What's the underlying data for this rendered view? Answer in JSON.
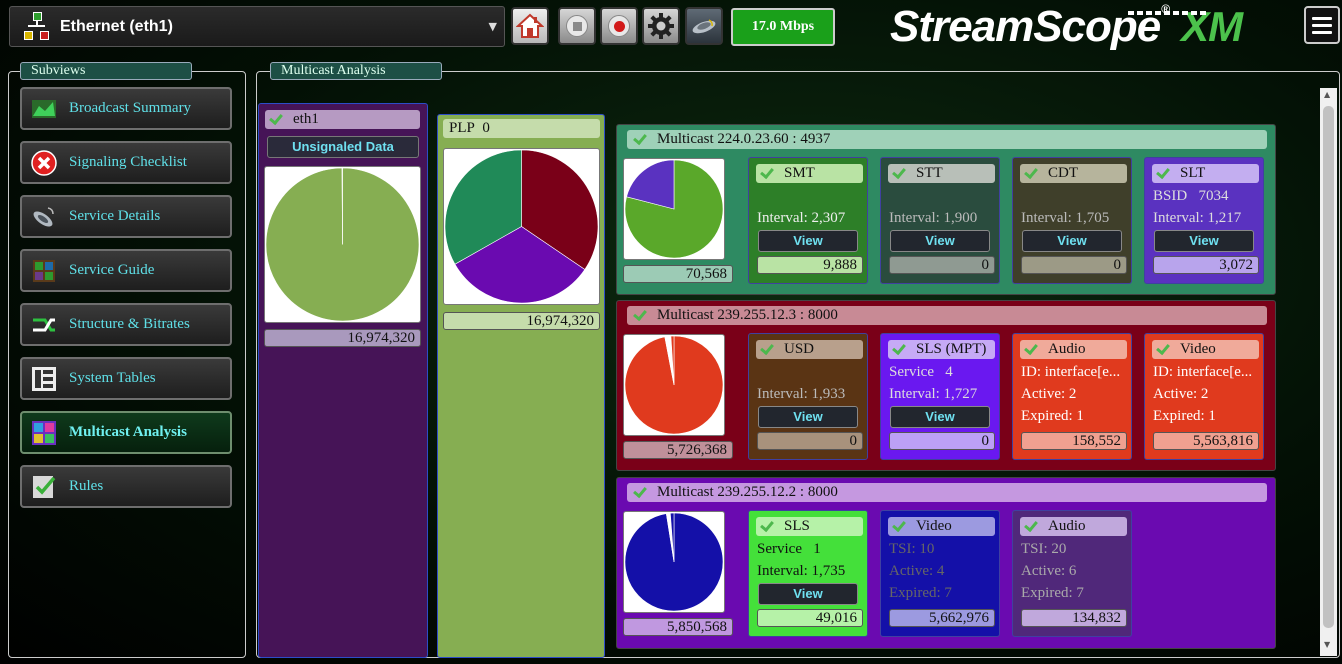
{
  "topbar": {
    "network_label": "Ethernet (eth1)",
    "bitrate": "17.0 Mbps",
    "logo_text": "StreamScope",
    "logo_reg": "®",
    "logo_xm": "XM",
    "icons": [
      "network-icon",
      "home-icon",
      "stop-icon",
      "record-icon",
      "gear-icon",
      "satellite-icon",
      "menu-icon"
    ]
  },
  "subviews": {
    "title": "Subviews",
    "items": [
      {
        "label": "Broadcast Summary",
        "icon": "chart-icon"
      },
      {
        "label": "Signaling Checklist",
        "icon": "error-x-icon"
      },
      {
        "label": "Service Details",
        "icon": "satellite-icon"
      },
      {
        "label": "Service Guide",
        "icon": "grid-guide-icon"
      },
      {
        "label": "Structure & Bitrates",
        "icon": "structure-arrows-icon"
      },
      {
        "label": "System Tables",
        "icon": "tables-icon"
      },
      {
        "label": "Multicast Analysis",
        "icon": "multicast-icon",
        "active": true
      },
      {
        "label": "Rules",
        "icon": "rules-check-icon"
      }
    ]
  },
  "main": {
    "title": "Multicast Analysis",
    "eth": {
      "label": "eth1",
      "unsignaled_button": "Unsignaled Data",
      "total": "16,974,320",
      "pie": {
        "slices": [
          {
            "value": 99.9,
            "color": "#86ae52"
          },
          {
            "value": 0.1,
            "color": "#ffffff"
          }
        ]
      }
    },
    "plp": {
      "label": "PLP",
      "number": "0",
      "total": "16,974,320",
      "pie": {
        "slices": [
          {
            "value": 34.5,
            "color": "#7a0018"
          },
          {
            "value": 32.3,
            "color": "#6a0ab0"
          },
          {
            "value": 33.2,
            "color": "#208a58"
          }
        ]
      }
    },
    "multicasts": [
      {
        "title": "Multicast 224.0.23.60 : 4937",
        "bg": "#2e8a62",
        "title_bg": "#9fd1b8",
        "val_bg": "#9ccbb5",
        "total": "70,568",
        "pie": {
          "slices": [
            {
              "value": 79,
              "color": "#5aa82a"
            },
            {
              "value": 21,
              "color": "#5a32c0"
            }
          ]
        },
        "cards": [
          {
            "name": "SMT",
            "bg": "#2d7f28",
            "name_bg": "#b9e3a4",
            "val_bg": "#b9e3a4",
            "line1": "",
            "line2": "",
            "line3": "Interval: 2,307",
            "view": "View",
            "value": "9,888",
            "text_color": "#eee"
          },
          {
            "name": "STT",
            "bg": "#2a4c3e",
            "name_bg": "#b8bfb8",
            "val_bg": "#8f9a92",
            "line1": "",
            "line2": "",
            "line3": "Interval: 1,900",
            "view": "View",
            "value": "0",
            "text_color": "#bbb"
          },
          {
            "name": "CDT",
            "bg": "#3f3f2a",
            "name_bg": "#b6b49c",
            "val_bg": "#9c9a86",
            "line1": "",
            "line2": "",
            "line3": "Interval: 1,705",
            "view": "View",
            "value": "0",
            "text_color": "#bbb"
          },
          {
            "name": "SLT",
            "bg": "#5a32c0",
            "name_bg": "#c3aef0",
            "val_bg": "#b8a4ec",
            "line1": "BSID",
            "line1_val": "7034",
            "line2": "",
            "line3": "Interval: 1,217",
            "view": "View",
            "value": "3,072",
            "text_color": "#ddd"
          }
        ]
      },
      {
        "title": "Multicast 239.255.12.3 : 8000",
        "bg": "#7a0018",
        "title_bg": "#c88a95",
        "val_bg": "#c0909a",
        "total": "5,726,368",
        "pie": {
          "slices": [
            {
              "value": 97,
              "color": "#e03a1e"
            },
            {
              "value": 2,
              "color": "#ffffff"
            },
            {
              "value": 1,
              "color": "#e03a1e"
            }
          ]
        },
        "cards": [
          {
            "name": "USD",
            "bg": "#5a3414",
            "name_bg": "#b8a08c",
            "val_bg": "#a8927c",
            "line1": "",
            "line2": "",
            "line3": "Interval: 1,933",
            "view": "View",
            "value": "0",
            "text_color": "#bbb"
          },
          {
            "name": "SLS (MPT)",
            "bg": "#6a18f0",
            "name_bg": "#c6aaf6",
            "val_bg": "#bca0f6",
            "line1": "Service",
            "line1_val": "4",
            "line2": "Interval: 1,727",
            "line3": "",
            "view": "View",
            "value": "0",
            "text_color": "#ddd"
          },
          {
            "name": "Audio",
            "bg": "#e03a1e",
            "name_bg": "#f0aa9a",
            "val_bg": "#f0a090",
            "line1": "ID: interface[e...",
            "line2": "Active:   2",
            "line3": "Expired: 1",
            "view": "",
            "value": "158,552",
            "text_color": "#fff"
          },
          {
            "name": "Video",
            "bg": "#e03a1e",
            "name_bg": "#f0aa9a",
            "val_bg": "#f0a090",
            "line1": "ID: interface[e...",
            "line2": "Active:   2",
            "line3": "Expired: 1",
            "view": "",
            "value": "5,563,816",
            "text_color": "#fff"
          }
        ]
      },
      {
        "title": "Multicast 239.255.12.2 : 8000",
        "bg": "#6a0ab0",
        "title_bg": "#c598e0",
        "val_bg": "#c098e0",
        "total": "5,850,568",
        "pie": {
          "slices": [
            {
              "value": 97.5,
              "color": "#1410a8"
            },
            {
              "value": 1.3,
              "color": "#ffffff"
            },
            {
              "value": 1.2,
              "color": "#1410a8"
            }
          ]
        },
        "cards": [
          {
            "name": "SLS",
            "bg": "#44e03a",
            "name_bg": "#b6f2a8",
            "val_bg": "#b6f2a8",
            "line1": "Service",
            "line1_val": "1",
            "line2": "Interval: 1,735",
            "line3": "",
            "view": "View",
            "value": "49,016",
            "text_color": "#111"
          },
          {
            "name": "Video",
            "bg": "#1410a8",
            "name_bg": "#9c9ae0",
            "val_bg": "#9c9ae0",
            "line1": "TSI: 10",
            "line2": "Active:   4",
            "line3": "Expired: 7",
            "view": "",
            "value": "5,662,976",
            "text_color": "#666"
          },
          {
            "name": "Audio",
            "bg": "#50287a",
            "name_bg": "#c0a8dc",
            "val_bg": "#c0a8dc",
            "line1": "TSI: 20",
            "line2": "Active:   6",
            "line3": "Expired: 7",
            "view": "",
            "value": "134,832",
            "text_color": "#aaa"
          }
        ]
      }
    ]
  }
}
